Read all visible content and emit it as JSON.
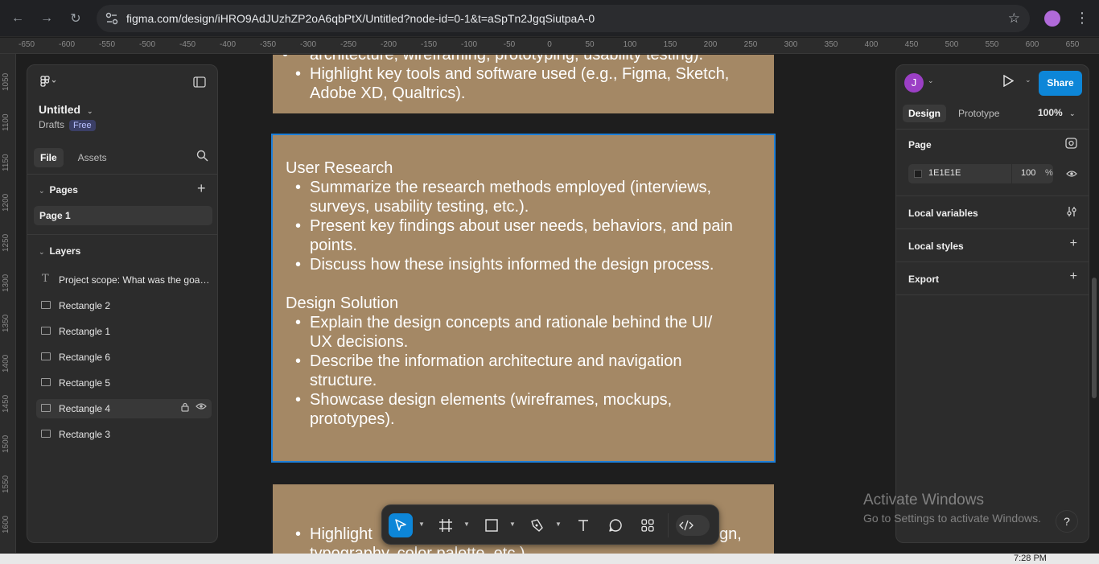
{
  "browser": {
    "url": "figma.com/design/iHRO9AdJUzhZP2oA6qbPtX/Untitled?node-id=0-1&t=aSpTn2JgqSiutpaA-0"
  },
  "ruler": {
    "top_ticks": [
      "-650",
      "-600",
      "-550",
      "-500",
      "-450",
      "-400",
      "-350",
      "-300",
      "-250",
      "-200",
      "-150",
      "-100",
      "-50",
      "0",
      "50",
      "100",
      "150",
      "200",
      "250",
      "300",
      "350",
      "400",
      "450",
      "500",
      "550",
      "600",
      "650"
    ],
    "left_ticks": [
      "1050",
      "1100",
      "1150",
      "1200",
      "1250",
      "1300",
      "1350",
      "1400",
      "1450",
      "1500",
      "1550",
      "1600"
    ]
  },
  "canvas": {
    "frame_top": {
      "items": [
        "architecture, wireframing, prototyping, usability testing).",
        "Highlight key tools and software used (e.g., Figma, Sketch, Adobe XD, Qualtrics)."
      ]
    },
    "frame_middle": {
      "section1_title": "User Research",
      "section1_items": [
        "Summarize the research methods employed (interviews, surveys, usability testing, etc.).",
        "Present key findings about user needs, behaviors, and pain points.",
        "Discuss how these insights informed the design process."
      ],
      "section2_title": "Design Solution",
      "section2_items": [
        "Explain the design concepts and rationale behind the UI/ UX decisions.",
        "Describe the information architecture and navigation structure.",
        "Showcase design elements (wireframes, mockups, prototypes)."
      ]
    },
    "frame_bottom": {
      "items": [
        "Highlight",
        "gn,",
        "typography, color palette, etc.)."
      ]
    }
  },
  "left_panel": {
    "file_name": "Untitled",
    "drafts": "Drafts",
    "badge": "Free",
    "tabs": [
      "File",
      "Assets"
    ],
    "pages_title": "Pages",
    "pages": [
      "Page 1"
    ],
    "layers_title": "Layers",
    "layers": [
      {
        "name": "Project scope: What was the goal ...",
        "type": "text"
      },
      {
        "name": "Rectangle 2",
        "type": "rect"
      },
      {
        "name": "Rectangle 1",
        "type": "rect"
      },
      {
        "name": "Rectangle 6",
        "type": "rect"
      },
      {
        "name": "Rectangle 5",
        "type": "rect"
      },
      {
        "name": "Rectangle 4",
        "type": "rect"
      },
      {
        "name": "Rectangle 3",
        "type": "rect"
      }
    ]
  },
  "right_panel": {
    "avatar_initial": "J",
    "share": "Share",
    "tabs": [
      "Design",
      "Prototype"
    ],
    "zoom": "100%",
    "page_section": "Page",
    "fill_hex": "1E1E1E",
    "fill_opacity": "100",
    "fill_unit": "%",
    "local_variables": "Local variables",
    "local_styles": "Local styles",
    "export": "Export"
  },
  "watermark": {
    "title": "Activate Windows",
    "subtitle": "Go to Settings to activate Windows."
  },
  "taskbar": {
    "time": "7:28 PM"
  },
  "colors": {
    "frame_fill": "#a48865",
    "accent": "#0d86d8",
    "selection": "#1e7fd8"
  }
}
